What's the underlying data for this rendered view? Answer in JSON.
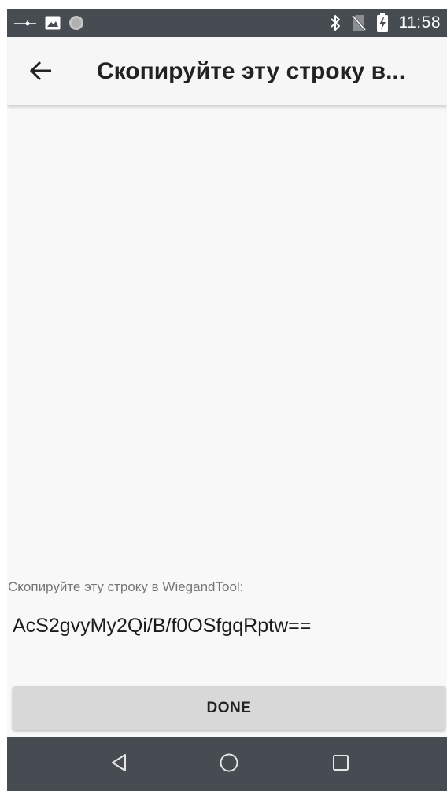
{
  "status_bar": {
    "time": "11:58",
    "icons": [
      "voicemail-icon",
      "image-icon",
      "circle-icon",
      "bluetooth-icon",
      "no-sim-icon",
      "battery-charging-icon"
    ]
  },
  "toolbar": {
    "title": "Скопируйте эту строку в...",
    "back_icon": "arrow-left-icon"
  },
  "content": {
    "label": "Скопируйте эту строку в WiegandTool:",
    "value": "AcS2gvyMy2Qi/B/f0OSfgqRptw=="
  },
  "button": {
    "label": "DONE"
  },
  "nav_bar": {
    "icons": [
      "back-triangle-icon",
      "home-circle-icon",
      "recents-square-icon"
    ]
  },
  "colors": {
    "status_bar": "#474b52",
    "toolbar": "#f6f6f6",
    "background": "#f8f8f8",
    "button": "#d8d8d8",
    "nav_bar": "#474b52"
  }
}
